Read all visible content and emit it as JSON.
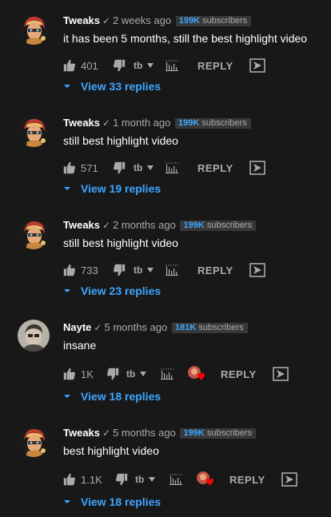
{
  "labels": {
    "reply": "REPLY"
  },
  "colors": {
    "background": "#181818",
    "link": "#3ea6ff",
    "muted": "#aaaaaa",
    "heart": "#ff0000"
  },
  "comments": [
    {
      "author": "Tweaks",
      "verified": "✓",
      "time": "2 weeks ago",
      "subs_count": "199K",
      "subs_label": "subscribers",
      "text": "it has been 5 months, still the best highlight video",
      "likes": "401",
      "view_replies": "View 33 replies",
      "avatar_icon": "fortnite-skin-avatar",
      "hearted": false
    },
    {
      "author": "Tweaks",
      "verified": "✓",
      "time": "1 month ago",
      "subs_count": "199K",
      "subs_label": "subscribers",
      "text": "still best highlight video",
      "likes": "571",
      "view_replies": "View 19 replies",
      "avatar_icon": "fortnite-skin-avatar",
      "hearted": false
    },
    {
      "author": "Tweaks",
      "verified": "✓",
      "time": "2 months ago",
      "subs_count": "199K",
      "subs_label": "subscribers",
      "text": "still best highlight video",
      "likes": "733",
      "view_replies": "View 23 replies",
      "avatar_icon": "fortnite-skin-avatar",
      "hearted": false
    },
    {
      "author": "Nayte",
      "verified": "✓",
      "time": "5 months ago",
      "subs_count": "181K",
      "subs_label": "subscribers",
      "text": "insane",
      "likes": "1K",
      "view_replies": "View 18 replies",
      "avatar_icon": "person-photo-avatar",
      "hearted": true
    },
    {
      "author": "Tweaks",
      "verified": "✓",
      "time": "5 months ago",
      "subs_count": "199K",
      "subs_label": "subscribers",
      "text": "best highlight video",
      "likes": "1.1K",
      "view_replies": "View 18 replies",
      "avatar_icon": "fortnite-skin-avatar",
      "hearted": true
    }
  ]
}
